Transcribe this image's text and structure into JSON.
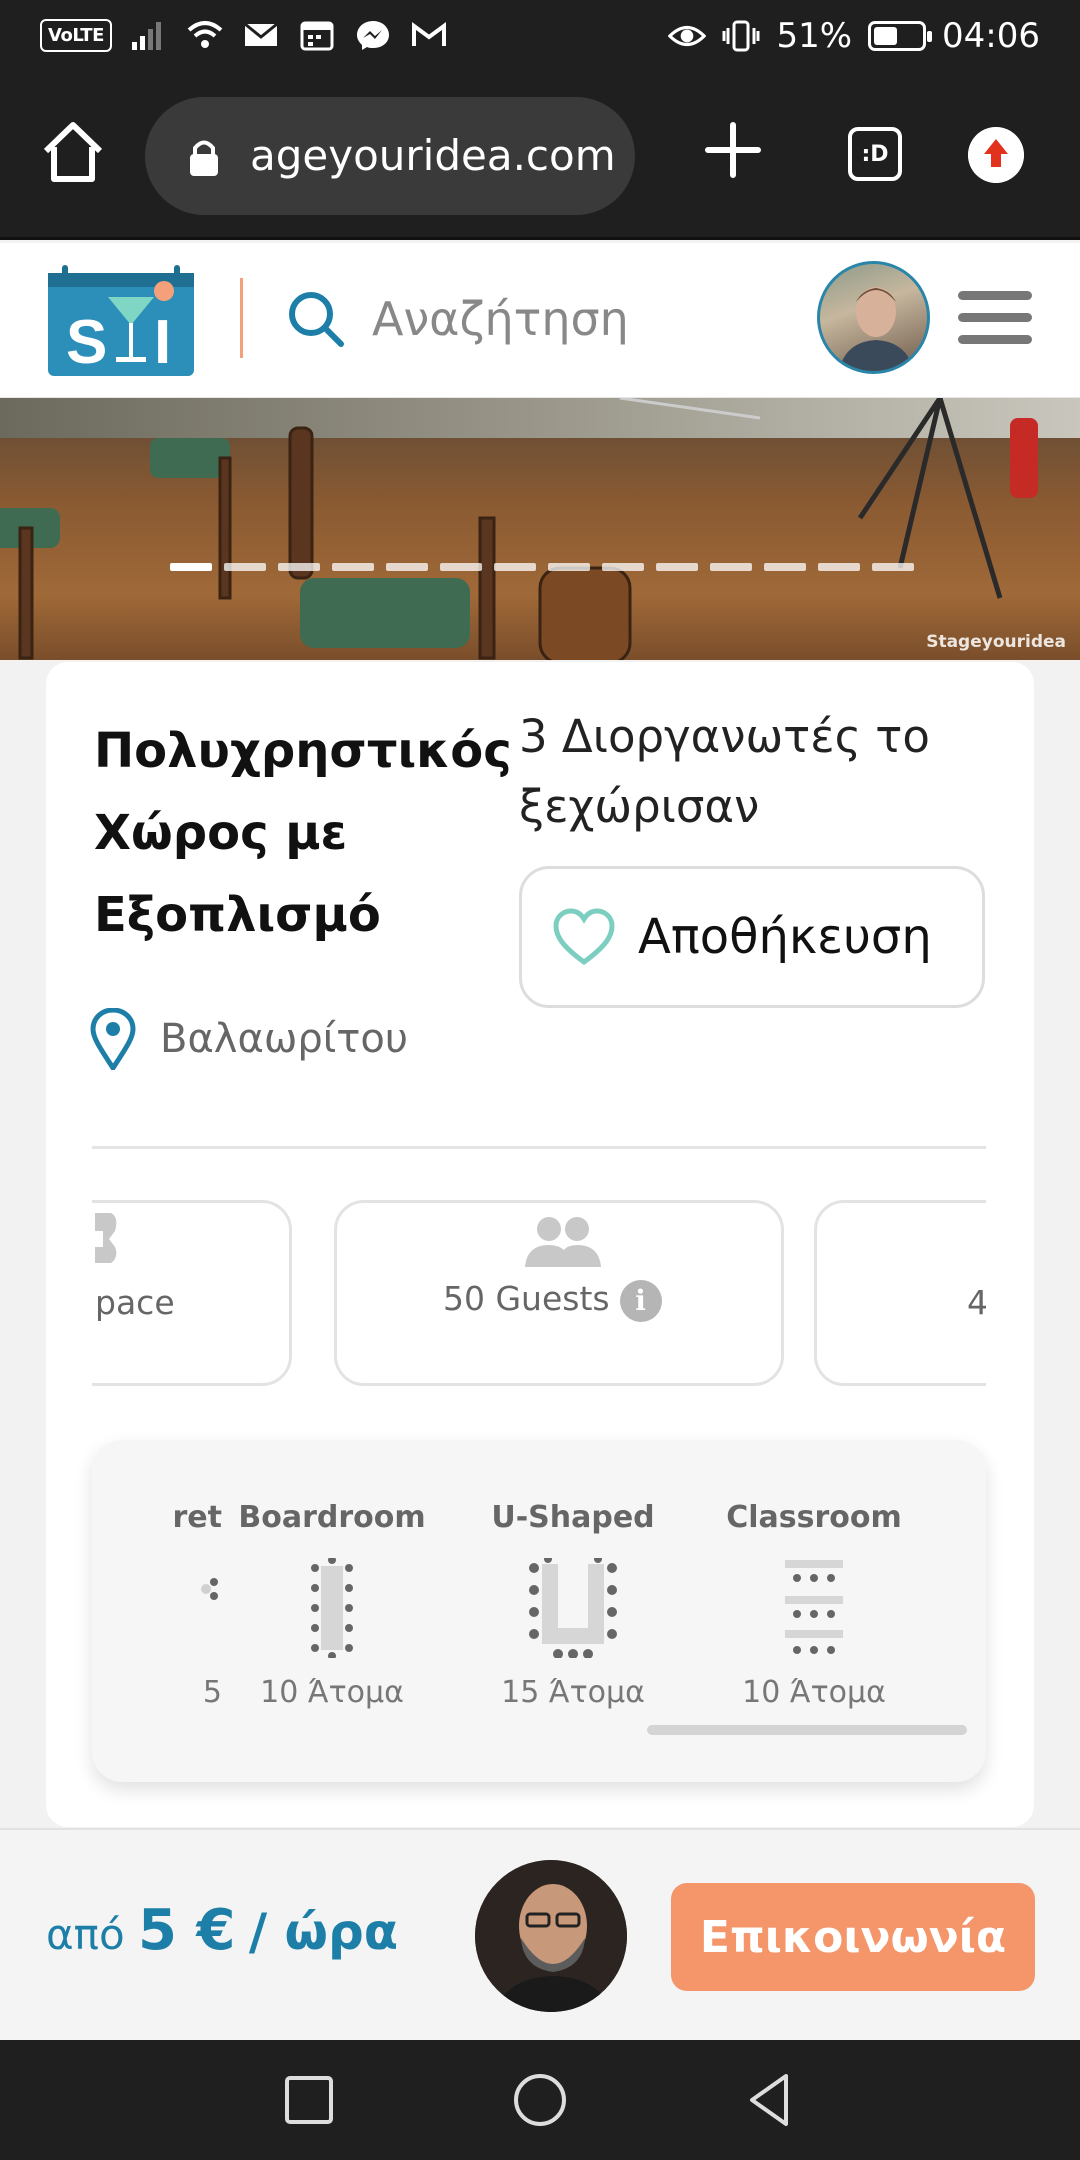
{
  "status_bar": {
    "volte": "VoLTE",
    "battery_percent": "51%",
    "battery_level": 0.51,
    "time": "04:06",
    "icons": [
      "signal-icon",
      "wifi-icon",
      "mail-icon",
      "calendar-icon",
      "messenger-icon",
      "gmail-icon",
      "eye-icon",
      "vibrate-icon",
      "battery-icon"
    ]
  },
  "browser": {
    "url": "ageyouridea.com",
    "tabs_label": ":D"
  },
  "header": {
    "logo_text": "SYI",
    "search_placeholder": "Αναζήτηση"
  },
  "hero": {
    "watermark": "Stageyouridea",
    "slide_count": 14,
    "active_slide": 0
  },
  "listing": {
    "title": "Πολυχρηστικός Χώρος με Εξοπλισμό",
    "organizers_text": "3 Διοργανωτές το ξεχώρισαν",
    "save_label": "Αποθήκευση",
    "location": "Βαλαωρίτου"
  },
  "features": [
    {
      "label": "pace"
    },
    {
      "label": "50 Guests",
      "info": "i"
    },
    {
      "label": "4"
    }
  ],
  "layouts": [
    {
      "name": "ret",
      "capacity": "5"
    },
    {
      "name": "Boardroom",
      "capacity": "10 Άτομα"
    },
    {
      "name": "U-Shaped",
      "capacity": "15 Άτομα"
    },
    {
      "name": "Classroom",
      "capacity": "10 Άτομα"
    }
  ],
  "cta": {
    "price_prefix": "από",
    "price_amount": "5 €",
    "price_unit": "/ ώρα",
    "contact_label": "Επικοινωνία"
  },
  "colors": {
    "accent_blue": "#1d7fa8",
    "cta_orange": "#f4956a",
    "heart_teal": "#7ccfc0"
  }
}
